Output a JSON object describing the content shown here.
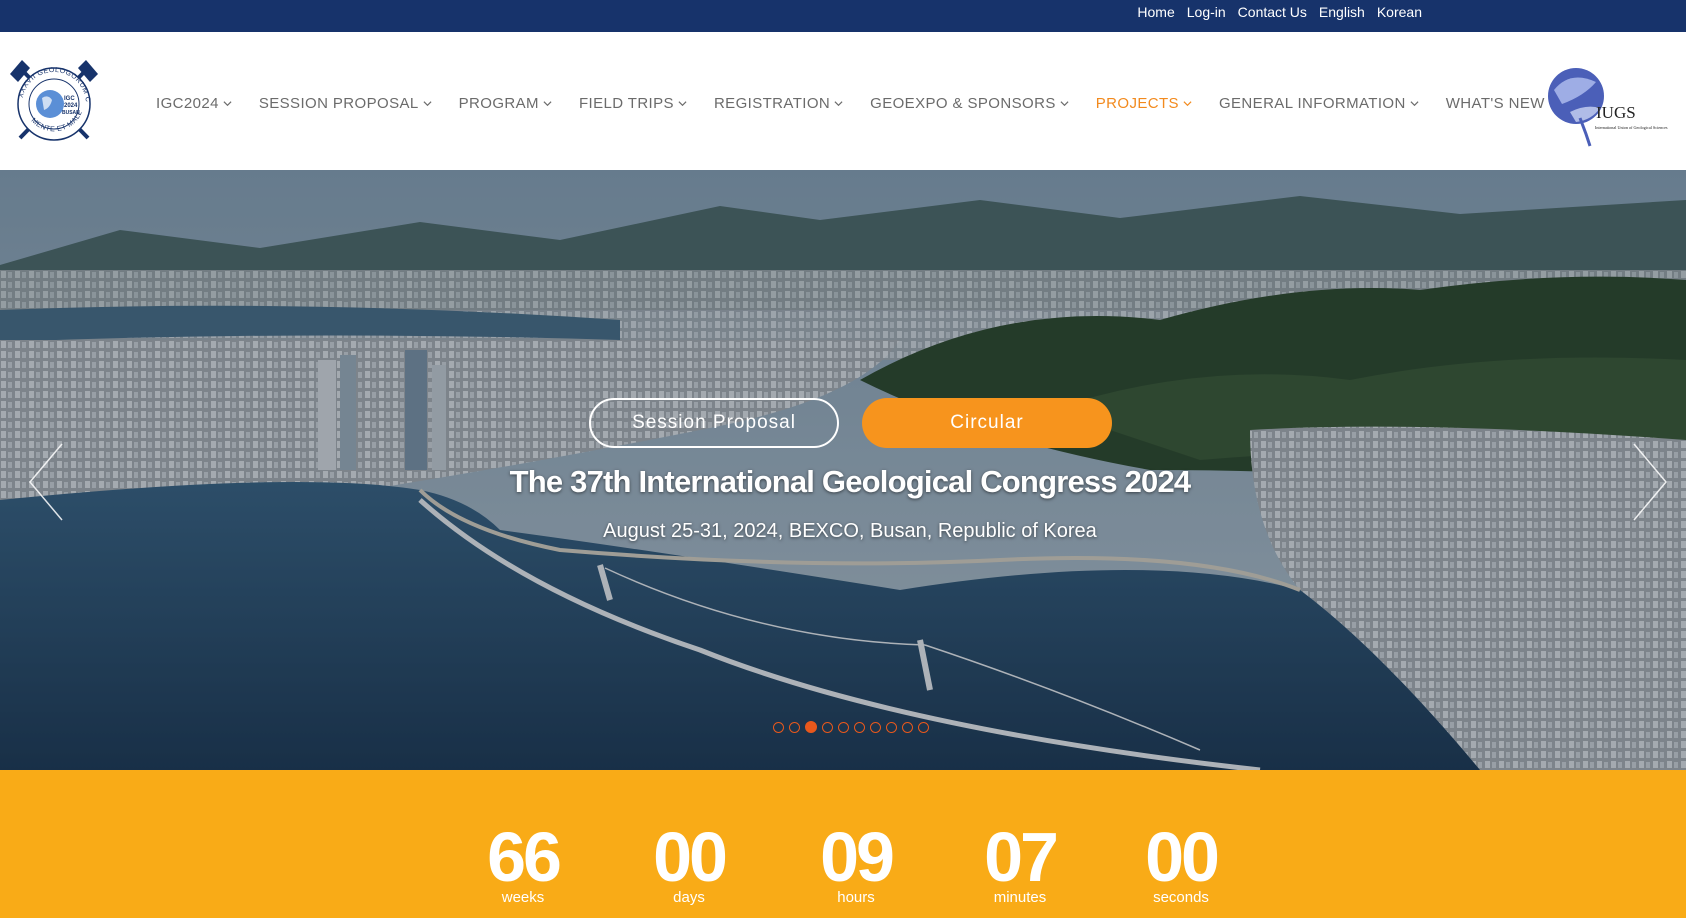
{
  "topbar": {
    "links": [
      "Home",
      "Log-in",
      "Contact Us",
      "English",
      "Korean"
    ]
  },
  "logos": {
    "igc": {
      "ring_text": "XXXVII GEOLOGORUM CONVENTUS",
      "motto": "MENTE ET MALLEO",
      "center_lines": [
        "IGC",
        "2024",
        "BUSAN"
      ]
    },
    "iugs": {
      "abbr": "IUGS",
      "full": "International Union of Geological Sciences"
    }
  },
  "nav": {
    "items": [
      {
        "label": "IGC2024",
        "active": false
      },
      {
        "label": "SESSION PROPOSAL",
        "active": false
      },
      {
        "label": "PROGRAM",
        "active": false
      },
      {
        "label": "FIELD TRIPS",
        "active": false
      },
      {
        "label": "REGISTRATION",
        "active": false
      },
      {
        "label": "GEOEXPO & SPONSORS",
        "active": false
      },
      {
        "label": "PROJECTS",
        "active": true
      },
      {
        "label": "GENERAL INFORMATION",
        "active": false
      },
      {
        "label": "WHAT'S NEW",
        "active": false
      }
    ]
  },
  "hero": {
    "buttons": {
      "session_proposal": "Session Proposal",
      "circular": "Circular"
    },
    "title": "The 37th International Geological Congress 2024",
    "subtitle": "August 25-31, 2024, BEXCO, Busan, Republic of Korea",
    "slide_count": 10,
    "active_slide": 3
  },
  "countdown": {
    "units": [
      {
        "value": "66",
        "label": "weeks"
      },
      {
        "value": "00",
        "label": "days"
      },
      {
        "value": "09",
        "label": "hours"
      },
      {
        "value": "07",
        "label": "minutes"
      },
      {
        "value": "00",
        "label": "seconds"
      }
    ]
  },
  "colors": {
    "topbar": "#17336b",
    "accent_orange": "#f7941d",
    "countdown_bg": "#f9ab17",
    "nav_text": "#6b6b6b",
    "nav_active": "#f28a1e"
  },
  "icons": {
    "prev": "chevron-left-icon",
    "next": "chevron-right-icon",
    "nav_dropdown": "chevron-down-icon"
  }
}
